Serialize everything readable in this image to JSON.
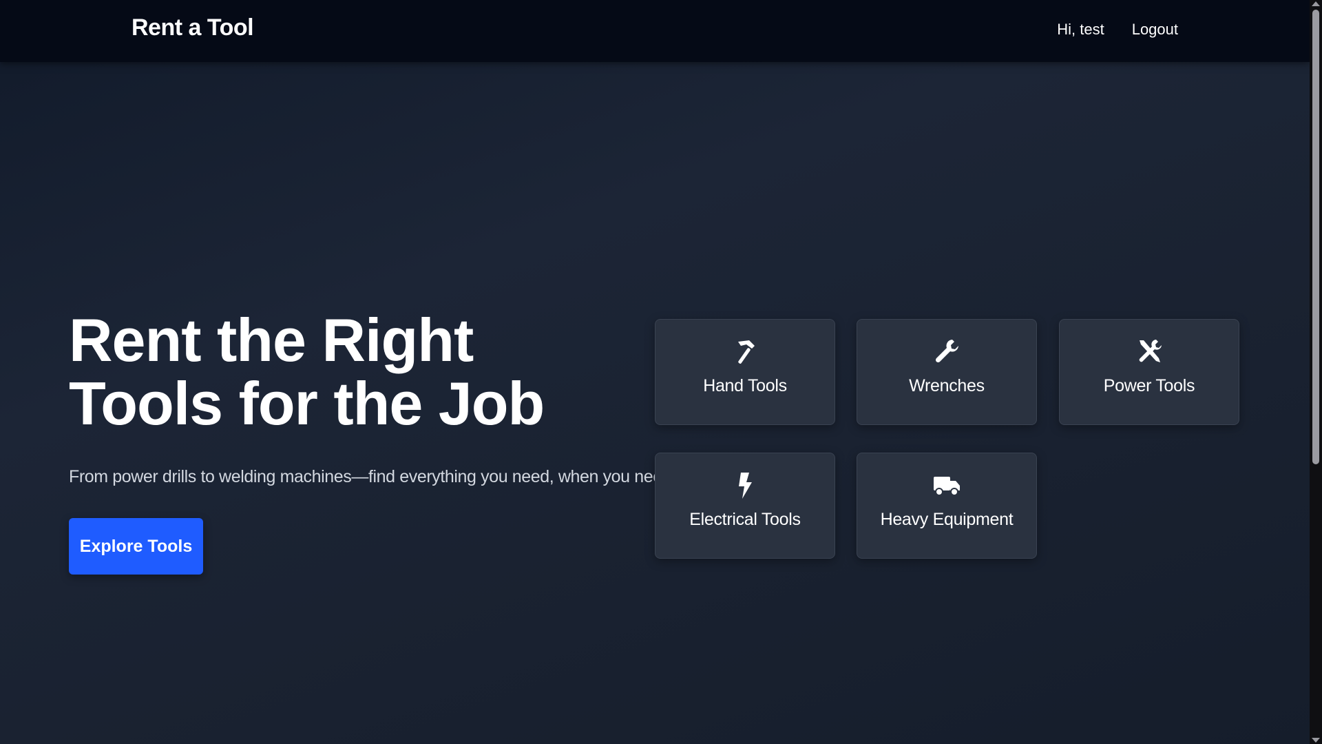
{
  "nav": {
    "brand": "Rent a Tool",
    "greeting": "Hi, test",
    "logout": "Logout"
  },
  "hero": {
    "title": "Rent the Right Tools for the Job",
    "subtitle": "From power drills to welding machines—find everything you need, when you need it.",
    "cta": "Explore Tools"
  },
  "categories": [
    {
      "label": "Hand Tools",
      "icon": "hammer-icon"
    },
    {
      "label": "Wrenches",
      "icon": "wrench-icon"
    },
    {
      "label": "Power Tools",
      "icon": "tools-icon"
    },
    {
      "label": "Electrical Tools",
      "icon": "lightning-bolt-icon"
    },
    {
      "label": "Heavy Equipment",
      "icon": "truck-icon"
    }
  ],
  "colors": {
    "accent": "#1f5cff",
    "navbar": "#050a16",
    "card": "#2a3240"
  }
}
